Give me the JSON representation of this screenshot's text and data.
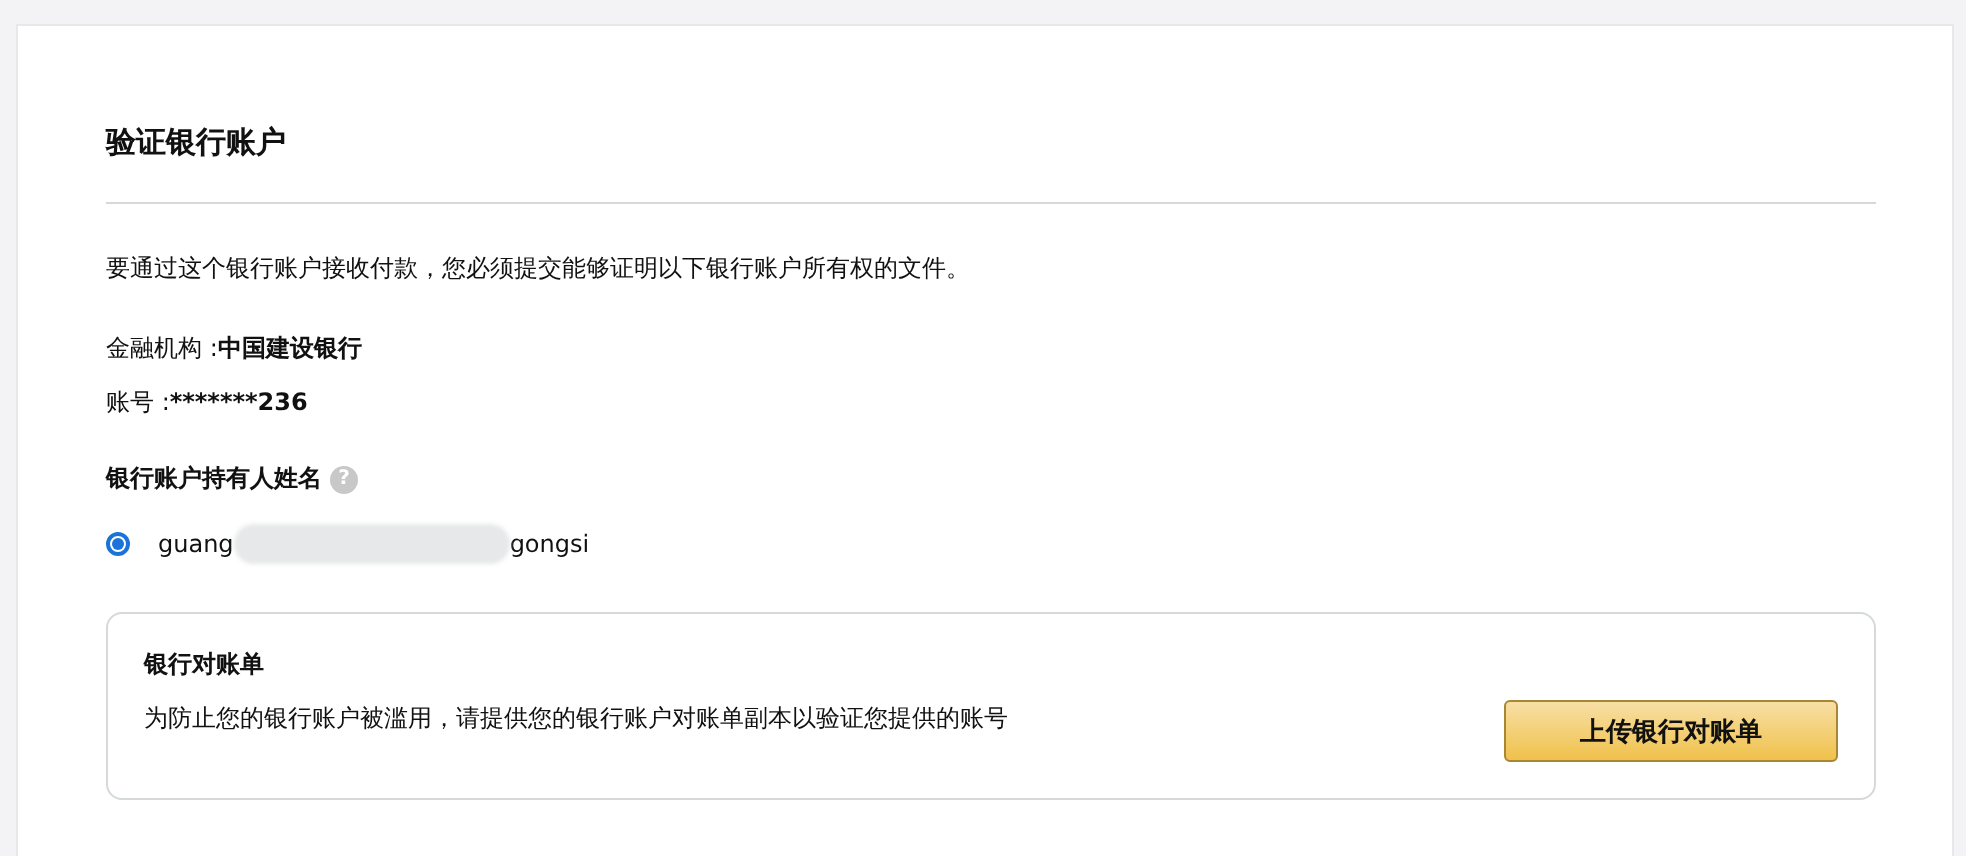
{
  "title": "验证银行账户",
  "intro": "要通过这个银行账户接收付款，您必须提交能够证明以下银行账户所有权的文件。",
  "institution": {
    "label": "金融机构 : ",
    "value": "中国建设银行"
  },
  "account": {
    "label": "账号 : ",
    "value": "*******236"
  },
  "holder": {
    "label": "银行账户持有人姓名",
    "help_icon": "?",
    "options": [
      {
        "name_start": "guang",
        "name_end": "gongsi",
        "selected": true
      }
    ]
  },
  "statement": {
    "title": "银行对账单",
    "description": "为防止您的银行账户被滥用，请提供您的银行账户对账单副本以验证您提供的账号",
    "button": "上传银行对账单"
  }
}
